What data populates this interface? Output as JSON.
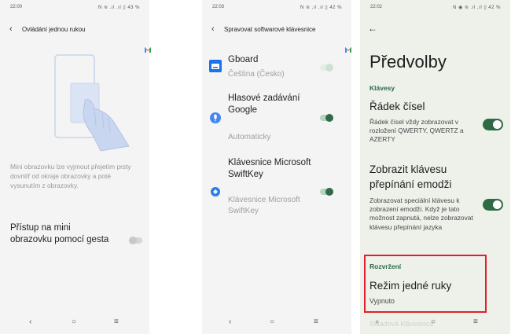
{
  "screens": [
    {
      "status": {
        "time": "22:00",
        "icons": "N ≋ .ıl .ıl ▯ 43 %"
      },
      "header": {
        "title": "Ovládání jednou rukou"
      },
      "description": "Mini obrazovku lze vyjmout přejetím prsty dovnitř od okraje obrazovky a poté vysunutím z obrazovky.",
      "setting": {
        "label": "Přístup na mini obrazovku pomocí gesta",
        "enabled": false
      }
    },
    {
      "status": {
        "time": "22:03",
        "icons": "N ≋ .ıl .ıl ▯ 42 %"
      },
      "header": {
        "title": "Spravovat softwarové klávesnice"
      },
      "keyboards": [
        {
          "name": "Gboard",
          "subtitle": "Čeština (Česko)",
          "enabled": true
        },
        {
          "name": "Hlasové zadávání Google",
          "subtitle": "Automaticky",
          "enabled": true
        },
        {
          "name": "Klávesnice Microsoft SwiftKey",
          "subtitle": "Klávesnice Microsoft SwiftKey",
          "enabled": true
        }
      ]
    },
    {
      "status": {
        "time": "22:02",
        "icons": "N ◉ ≋ .ıl .ıl ▯ 42 %"
      },
      "title": "Předvolby",
      "sections": {
        "keys": "Klávesy",
        "layout": "Rozvržení"
      },
      "prefs": {
        "number_row": {
          "title": "Řádek čísel",
          "subtitle": "Řádek čísel vždy zobrazovat v rozložení QWERTY, QWERTZ a AZERTY",
          "enabled": true
        },
        "emoji_key": {
          "title": "Zobrazit klávesu přepínání emodži",
          "subtitle": "Zobrazovat speciální klávesu k zobrazení emodži. Když je tato možnost zapnutá, nelze zobrazovat klávesu přepínání jazyka",
          "enabled": true
        },
        "one_hand": {
          "title": "Režim jedné ruky",
          "subtitle": "Vypnuto"
        }
      },
      "faded_next": "Skladová klávesnice"
    }
  ],
  "nav": {
    "back": "‹",
    "home": "○",
    "menu": "≡"
  },
  "colors": {
    "accent": "#2d6a45",
    "highlight": "#e0202a",
    "toggle_off": "#d6d6d6"
  }
}
